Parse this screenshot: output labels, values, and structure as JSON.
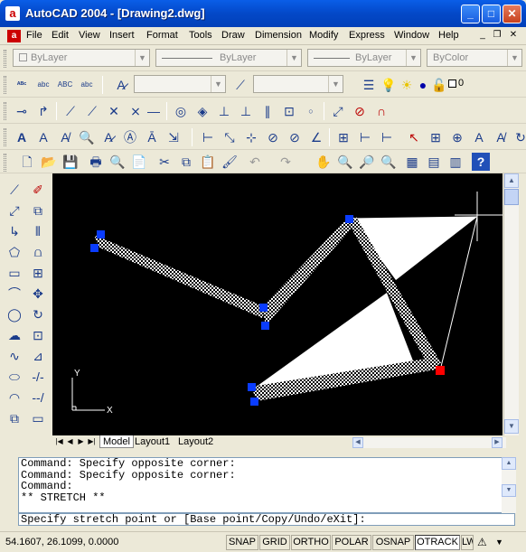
{
  "window": {
    "title": "AutoCAD 2004 - [Drawing2.dwg]",
    "app_icon": "a",
    "minimize": "_",
    "maximize": "□",
    "close": "✕"
  },
  "menubar": {
    "app_icon": "a",
    "items": [
      "File",
      "Edit",
      "View",
      "Insert",
      "Format",
      "Tools",
      "Draw",
      "Dimension",
      "Modify",
      "Express",
      "Window",
      "Help"
    ],
    "mdi_min": "_",
    "mdi_restore": "❐",
    "mdi_close": "✕"
  },
  "properties": {
    "layer": "ByLayer",
    "linetype": "ByLayer",
    "lineweight": "ByLayer",
    "color": "ByColor",
    "layer_value": "0"
  },
  "axis": {
    "x": "X",
    "y": "Y"
  },
  "tabs": {
    "model": "Model",
    "layout1": "Layout1",
    "layout2": "Layout2"
  },
  "command": {
    "history": [
      "Command: Specify opposite corner:",
      "Command: Specify opposite corner:",
      "Command:",
      "** STRETCH **"
    ],
    "prompt": "Specify stretch point or [Base point/Copy/Undo/eXit]:"
  },
  "status": {
    "coords": "54.1607, 26.1099, 0.0000",
    "buttons": [
      "SNAP",
      "GRID",
      "ORTHO",
      "POLAR",
      "OSNAP",
      "OTRACK",
      "LWT"
    ]
  },
  "colors": {
    "title_bar": "#0348c8",
    "canvas": "#000000",
    "grip_cold": "#0a3cff",
    "grip_hot": "#ff0000",
    "hatch": "#ffffff"
  }
}
